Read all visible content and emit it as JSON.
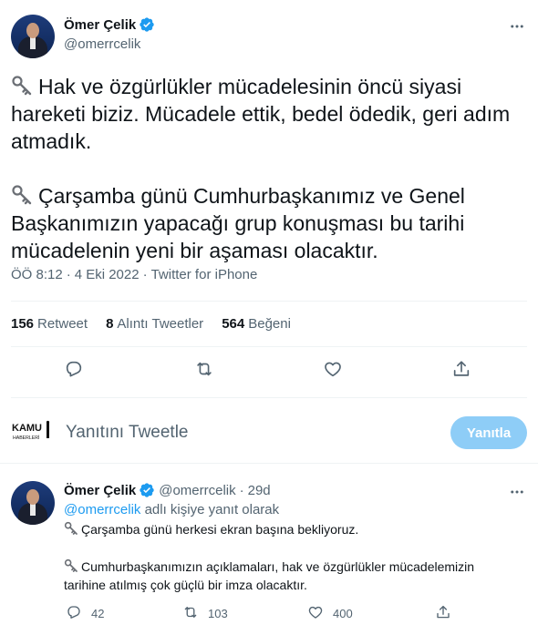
{
  "tweet": {
    "author": {
      "display_name": "Ömer Çelik",
      "handle": "@omerrcelik",
      "verified": true
    },
    "paragraph1": "Hak ve özgürlükler mücadelesinin öncü siyasi hareketi biziz. Mücadele ettik, bedel ödedik, geri adım atmadık.",
    "paragraph2": "Çarşamba günü Cumhurbaşkanımız ve Genel Başkanımızın yapacağı grup konuşması bu tarihi mücadelenin yeni bir aşaması olacaktır.",
    "time": "ÖÖ 8:12",
    "separator": "·",
    "date": "4 Eki 2022",
    "source": "Twitter for iPhone",
    "stats": {
      "retweets_count": "156",
      "retweets_label": "Retweet",
      "quotes_count": "8",
      "quotes_label": "Alıntı Tweetler",
      "likes_count": "564",
      "likes_label": "Beğeni"
    },
    "icons": [
      "reply-icon",
      "retweet-icon",
      "like-icon",
      "share-icon",
      "more-icon",
      "key-icon",
      "verified-icon"
    ]
  },
  "reply_composer": {
    "logo_top": "KAMU",
    "logo_bottom": "HABERLERİ",
    "placeholder": "Yanıtını Tweetle",
    "button_label": "Yanıtla"
  },
  "reply": {
    "author": {
      "display_name": "Ömer Çelik",
      "handle": "@omerrcelik",
      "age": "29d"
    },
    "separator": "·",
    "replying_to_handle": "@omerrcelik",
    "replying_to_suffix": "adlı kişiye yanıt olarak",
    "line1": "Çarşamba günü herkesi ekran başına bekliyoruz.",
    "line2": "Cumhurbaşkanımızın açıklamaları, hak ve özgürlükler mücadelemizin tarihine atılmış çok güçlü bir imza olacaktır.",
    "counts": {
      "replies": "42",
      "retweets": "103",
      "likes": "400"
    }
  },
  "colors": {
    "accent": "#1d9bf0",
    "button_disabled": "#8ecdf7",
    "secondary_text": "#536471",
    "divider": "#eff3f4"
  }
}
